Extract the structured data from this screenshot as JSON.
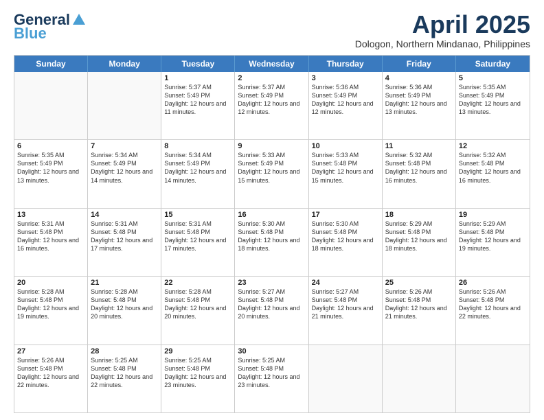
{
  "header": {
    "logo_general": "General",
    "logo_blue": "Blue",
    "main_title": "April 2025",
    "subtitle": "Dologon, Northern Mindanao, Philippines"
  },
  "days_of_week": [
    "Sunday",
    "Monday",
    "Tuesday",
    "Wednesday",
    "Thursday",
    "Friday",
    "Saturday"
  ],
  "weeks": [
    [
      {
        "day": "",
        "sunrise": "",
        "sunset": "",
        "daylight": ""
      },
      {
        "day": "",
        "sunrise": "",
        "sunset": "",
        "daylight": ""
      },
      {
        "day": "1",
        "sunrise": "Sunrise: 5:37 AM",
        "sunset": "Sunset: 5:49 PM",
        "daylight": "Daylight: 12 hours and 11 minutes."
      },
      {
        "day": "2",
        "sunrise": "Sunrise: 5:37 AM",
        "sunset": "Sunset: 5:49 PM",
        "daylight": "Daylight: 12 hours and 12 minutes."
      },
      {
        "day": "3",
        "sunrise": "Sunrise: 5:36 AM",
        "sunset": "Sunset: 5:49 PM",
        "daylight": "Daylight: 12 hours and 12 minutes."
      },
      {
        "day": "4",
        "sunrise": "Sunrise: 5:36 AM",
        "sunset": "Sunset: 5:49 PM",
        "daylight": "Daylight: 12 hours and 13 minutes."
      },
      {
        "day": "5",
        "sunrise": "Sunrise: 5:35 AM",
        "sunset": "Sunset: 5:49 PM",
        "daylight": "Daylight: 12 hours and 13 minutes."
      }
    ],
    [
      {
        "day": "6",
        "sunrise": "Sunrise: 5:35 AM",
        "sunset": "Sunset: 5:49 PM",
        "daylight": "Daylight: 12 hours and 13 minutes."
      },
      {
        "day": "7",
        "sunrise": "Sunrise: 5:34 AM",
        "sunset": "Sunset: 5:49 PM",
        "daylight": "Daylight: 12 hours and 14 minutes."
      },
      {
        "day": "8",
        "sunrise": "Sunrise: 5:34 AM",
        "sunset": "Sunset: 5:49 PM",
        "daylight": "Daylight: 12 hours and 14 minutes."
      },
      {
        "day": "9",
        "sunrise": "Sunrise: 5:33 AM",
        "sunset": "Sunset: 5:49 PM",
        "daylight": "Daylight: 12 hours and 15 minutes."
      },
      {
        "day": "10",
        "sunrise": "Sunrise: 5:33 AM",
        "sunset": "Sunset: 5:48 PM",
        "daylight": "Daylight: 12 hours and 15 minutes."
      },
      {
        "day": "11",
        "sunrise": "Sunrise: 5:32 AM",
        "sunset": "Sunset: 5:48 PM",
        "daylight": "Daylight: 12 hours and 16 minutes."
      },
      {
        "day": "12",
        "sunrise": "Sunrise: 5:32 AM",
        "sunset": "Sunset: 5:48 PM",
        "daylight": "Daylight: 12 hours and 16 minutes."
      }
    ],
    [
      {
        "day": "13",
        "sunrise": "Sunrise: 5:31 AM",
        "sunset": "Sunset: 5:48 PM",
        "daylight": "Daylight: 12 hours and 16 minutes."
      },
      {
        "day": "14",
        "sunrise": "Sunrise: 5:31 AM",
        "sunset": "Sunset: 5:48 PM",
        "daylight": "Daylight: 12 hours and 17 minutes."
      },
      {
        "day": "15",
        "sunrise": "Sunrise: 5:31 AM",
        "sunset": "Sunset: 5:48 PM",
        "daylight": "Daylight: 12 hours and 17 minutes."
      },
      {
        "day": "16",
        "sunrise": "Sunrise: 5:30 AM",
        "sunset": "Sunset: 5:48 PM",
        "daylight": "Daylight: 12 hours and 18 minutes."
      },
      {
        "day": "17",
        "sunrise": "Sunrise: 5:30 AM",
        "sunset": "Sunset: 5:48 PM",
        "daylight": "Daylight: 12 hours and 18 minutes."
      },
      {
        "day": "18",
        "sunrise": "Sunrise: 5:29 AM",
        "sunset": "Sunset: 5:48 PM",
        "daylight": "Daylight: 12 hours and 18 minutes."
      },
      {
        "day": "19",
        "sunrise": "Sunrise: 5:29 AM",
        "sunset": "Sunset: 5:48 PM",
        "daylight": "Daylight: 12 hours and 19 minutes."
      }
    ],
    [
      {
        "day": "20",
        "sunrise": "Sunrise: 5:28 AM",
        "sunset": "Sunset: 5:48 PM",
        "daylight": "Daylight: 12 hours and 19 minutes."
      },
      {
        "day": "21",
        "sunrise": "Sunrise: 5:28 AM",
        "sunset": "Sunset: 5:48 PM",
        "daylight": "Daylight: 12 hours and 20 minutes."
      },
      {
        "day": "22",
        "sunrise": "Sunrise: 5:28 AM",
        "sunset": "Sunset: 5:48 PM",
        "daylight": "Daylight: 12 hours and 20 minutes."
      },
      {
        "day": "23",
        "sunrise": "Sunrise: 5:27 AM",
        "sunset": "Sunset: 5:48 PM",
        "daylight": "Daylight: 12 hours and 20 minutes."
      },
      {
        "day": "24",
        "sunrise": "Sunrise: 5:27 AM",
        "sunset": "Sunset: 5:48 PM",
        "daylight": "Daylight: 12 hours and 21 minutes."
      },
      {
        "day": "25",
        "sunrise": "Sunrise: 5:26 AM",
        "sunset": "Sunset: 5:48 PM",
        "daylight": "Daylight: 12 hours and 21 minutes."
      },
      {
        "day": "26",
        "sunrise": "Sunrise: 5:26 AM",
        "sunset": "Sunset: 5:48 PM",
        "daylight": "Daylight: 12 hours and 22 minutes."
      }
    ],
    [
      {
        "day": "27",
        "sunrise": "Sunrise: 5:26 AM",
        "sunset": "Sunset: 5:48 PM",
        "daylight": "Daylight: 12 hours and 22 minutes."
      },
      {
        "day": "28",
        "sunrise": "Sunrise: 5:25 AM",
        "sunset": "Sunset: 5:48 PM",
        "daylight": "Daylight: 12 hours and 22 minutes."
      },
      {
        "day": "29",
        "sunrise": "Sunrise: 5:25 AM",
        "sunset": "Sunset: 5:48 PM",
        "daylight": "Daylight: 12 hours and 23 minutes."
      },
      {
        "day": "30",
        "sunrise": "Sunrise: 5:25 AM",
        "sunset": "Sunset: 5:48 PM",
        "daylight": "Daylight: 12 hours and 23 minutes."
      },
      {
        "day": "",
        "sunrise": "",
        "sunset": "",
        "daylight": ""
      },
      {
        "day": "",
        "sunrise": "",
        "sunset": "",
        "daylight": ""
      },
      {
        "day": "",
        "sunrise": "",
        "sunset": "",
        "daylight": ""
      }
    ]
  ]
}
